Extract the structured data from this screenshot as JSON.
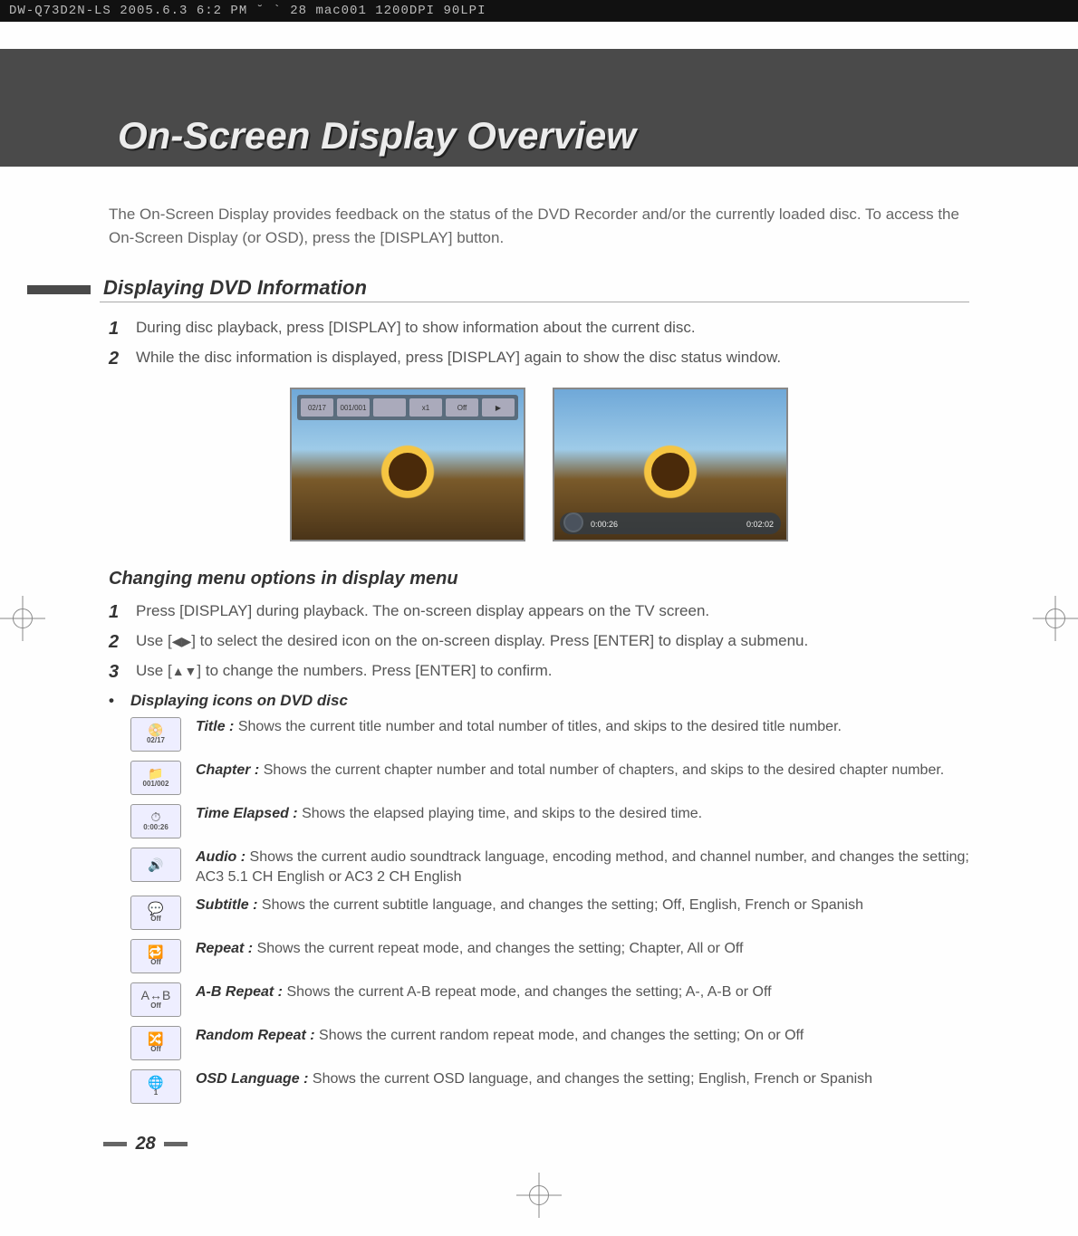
{
  "header_strip": "DW-Q73D2N-LS  2005.6.3 6:2 PM  ˘  `  28   mac001   1200DPI 90LPI",
  "main_title": "On-Screen Display Overview",
  "intro": "The On-Screen Display provides feedback on the status of the DVD Recorder and/or the currently loaded disc. To access the On-Screen Display (or OSD), press the [DISPLAY] button.",
  "section1_title": "Displaying DVD Information",
  "section1_steps": [
    "During disc playback, press [DISPLAY] to show information about the current disc.",
    "While the disc information is displayed, press [DISPLAY] again to show the disc status window."
  ],
  "osd_bar_cells": [
    "02/17",
    "001/001",
    "",
    "x1",
    "Off",
    "▶"
  ],
  "shot2": {
    "timeleft": "0:00:26",
    "timeright": "0:02:02"
  },
  "subsection_title": "Changing menu options in display menu",
  "change_steps": [
    {
      "num": "1",
      "text_before": "Press [DISPLAY] during playback. The on-screen display appears on the TV screen.",
      "arrows": ""
    },
    {
      "num": "2",
      "text_before": "Use [",
      "arrows": "◀▶",
      "text_after": "] to select the desired icon on the on-screen display. Press [ENTER] to display a submenu."
    },
    {
      "num": "3",
      "text_before": "Use [",
      "arrows": "▲▼",
      "text_after": "] to change the numbers. Press [ENTER] to confirm."
    }
  ],
  "bullet_heading": "Displaying icons on DVD disc",
  "icons": [
    {
      "glyph": "📀",
      "label": "02/17",
      "term": "Title :",
      "desc": "Shows the current title number and total number of titles, and skips to the desired title number."
    },
    {
      "glyph": "📁",
      "label": "001/002",
      "term": "Chapter :",
      "desc": "Shows the current chapter number and total number of chapters, and skips to the desired chapter number."
    },
    {
      "glyph": "⏱",
      "label": "0:00:26",
      "term": "Time Elapsed  :",
      "desc": "Shows the elapsed playing time, and skips to the desired time."
    },
    {
      "glyph": "🔊",
      "label": "",
      "term": "Audio :",
      "desc": "Shows the current audio soundtrack language, encoding method, and channel number, and changes the setting; AC3 5.1 CH English or AC3 2 CH English"
    },
    {
      "glyph": "💬",
      "label": "Off",
      "term": "Subtitle :",
      "desc": "Shows the current subtitle language, and changes the setting; Off, English, French or Spanish"
    },
    {
      "glyph": "🔁",
      "label": "Off",
      "term": "Repeat :",
      "desc": "Shows the current repeat mode, and changes the setting; Chapter, All or Off"
    },
    {
      "glyph": "A↔B",
      "label": "Off",
      "term": "A-B Repeat :",
      "desc": "Shows the current A-B repeat mode, and changes the setting; A-, A-B or Off"
    },
    {
      "glyph": "🔀",
      "label": "Off",
      "term": "Random Repeat :",
      "desc": "Shows the current random repeat mode, and changes the setting; On or Off"
    },
    {
      "glyph": "🌐",
      "label": "1",
      "term": "OSD Language :",
      "desc": "Shows the current OSD language, and changes the setting; English, French or Spanish"
    }
  ],
  "page_number": "28"
}
